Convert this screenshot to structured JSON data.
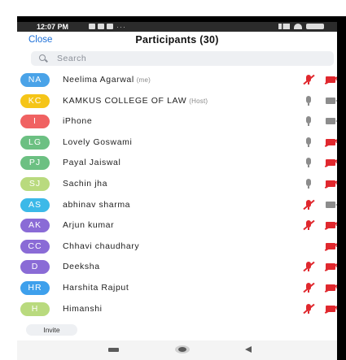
{
  "status_bar": {
    "time": "12:07 PM",
    "dots": "···"
  },
  "header": {
    "close_label": "Close",
    "title": "Participants (30)"
  },
  "search": {
    "placeholder": "Search"
  },
  "participants": [
    {
      "initials": "NA",
      "name": "Neelima Agarwal",
      "tag": "(me)",
      "color": "#4aa3e8",
      "mic": "red",
      "cam": "red"
    },
    {
      "initials": "KC",
      "name": "KAMKUS COLLEGE OF LAW",
      "tag": "(Host)",
      "color": "#f5c518",
      "mic": "grey",
      "cam": "grey"
    },
    {
      "initials": "I",
      "name": "iPhone",
      "tag": "",
      "color": "#f06262",
      "mic": "grey",
      "cam": "grey"
    },
    {
      "initials": "LG",
      "name": "Lovely Goswami",
      "tag": "",
      "color": "#6cc082",
      "mic": "grey",
      "cam": "red"
    },
    {
      "initials": "PJ",
      "name": "Payal Jaiswal",
      "tag": "",
      "color": "#6cc082",
      "mic": "grey",
      "cam": "red"
    },
    {
      "initials": "SJ",
      "name": "Sachin jha",
      "tag": "",
      "color": "#b9da7e",
      "mic": "grey",
      "cam": "red"
    },
    {
      "initials": "AS",
      "name": "abhinav sharma",
      "tag": "",
      "color": "#3cb9e8",
      "mic": "red",
      "cam": "grey"
    },
    {
      "initials": "AK",
      "name": "Arjun kumar",
      "tag": "",
      "color": "#8a6bd6",
      "mic": "red",
      "cam": "red"
    },
    {
      "initials": "CC",
      "name": "Chhavi chaudhary",
      "tag": "",
      "color": "#8a6bd6",
      "mic": "none",
      "cam": "red"
    },
    {
      "initials": "D",
      "name": "Deeksha",
      "tag": "",
      "color": "#8a6bd6",
      "mic": "red",
      "cam": "red"
    },
    {
      "initials": "HR",
      "name": "Harshita Rajput",
      "tag": "",
      "color": "#3ea0ec",
      "mic": "red",
      "cam": "red"
    },
    {
      "initials": "H",
      "name": "Himanshi",
      "tag": "",
      "color": "#b9da7e",
      "mic": "red",
      "cam": "red"
    }
  ],
  "footer": {
    "invite_label": "Invite"
  }
}
